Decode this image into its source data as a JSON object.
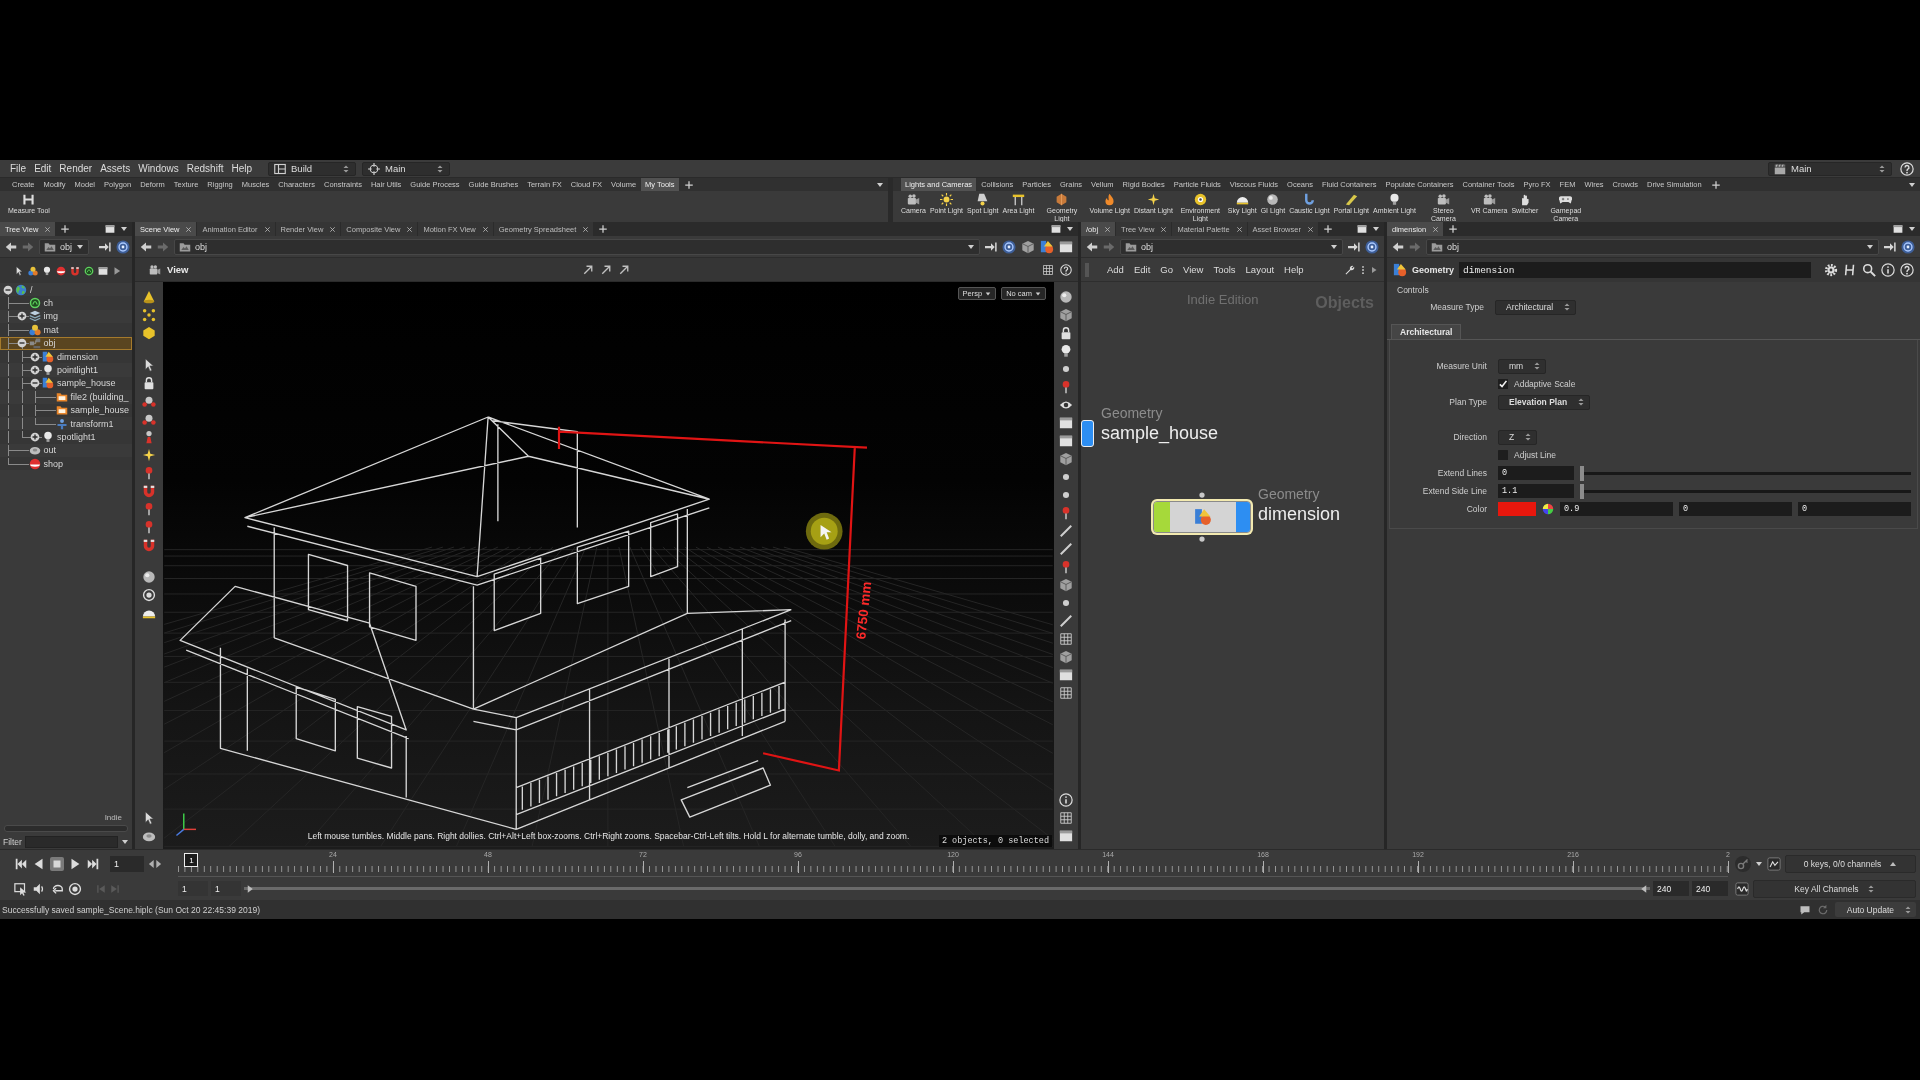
{
  "menu_bar": {
    "items": [
      "File",
      "Edit",
      "Render",
      "Assets",
      "Windows",
      "Redshift",
      "Help"
    ],
    "desktop": "Build",
    "main_menu": "Main",
    "right_menu": "Main"
  },
  "shelves": [
    {
      "tabs": [
        {
          "label": "Create",
          "selected": false
        },
        {
          "label": "Modify",
          "selected": false
        },
        {
          "label": "Model",
          "selected": false
        },
        {
          "label": "Polygon",
          "selected": false
        },
        {
          "label": "Deform",
          "selected": false
        },
        {
          "label": "Texture",
          "selected": false
        },
        {
          "label": "Rigging",
          "selected": false
        },
        {
          "label": "Muscles",
          "selected": false
        },
        {
          "label": "Characters",
          "selected": false
        },
        {
          "label": "Constraints",
          "selected": false
        },
        {
          "label": "Hair Utils",
          "selected": false
        },
        {
          "label": "Guide Process",
          "selected": false
        },
        {
          "label": "Guide Brushes",
          "selected": false
        },
        {
          "label": "Terrain FX",
          "selected": false
        },
        {
          "label": "Cloud FX",
          "selected": false
        },
        {
          "label": "Volume",
          "selected": false
        },
        {
          "label": "My Tools",
          "selected": true
        }
      ],
      "tools": [
        "Measure Tool"
      ]
    },
    {
      "tabs": [
        {
          "label": "Lights and Cameras",
          "selected": true
        },
        {
          "label": "Collisions",
          "selected": false
        },
        {
          "label": "Particles",
          "selected": false
        },
        {
          "label": "Grains",
          "selected": false
        },
        {
          "label": "Vellum",
          "selected": false
        },
        {
          "label": "Rigid Bodies",
          "selected": false
        },
        {
          "label": "Particle Fluids",
          "selected": false
        },
        {
          "label": "Viscous Fluids",
          "selected": false
        },
        {
          "label": "Oceans",
          "selected": false
        },
        {
          "label": "Fluid Containers",
          "selected": false
        },
        {
          "label": "Populate Containers",
          "selected": false
        },
        {
          "label": "Container Tools",
          "selected": false
        },
        {
          "label": "Pyro FX",
          "selected": false
        },
        {
          "label": "FEM",
          "selected": false
        },
        {
          "label": "Wires",
          "selected": false
        },
        {
          "label": "Crowds",
          "selected": false
        },
        {
          "label": "Drive Simulation",
          "selected": false
        }
      ],
      "tools": [
        "Camera",
        "Point Light",
        "Spot Light",
        "Area Light",
        "Geometry Light",
        "Volume Light",
        "Distant Light",
        "Environment Light",
        "Sky Light",
        "GI Light",
        "Caustic Light",
        "Portal Light",
        "Ambient Light",
        "Stereo Camera",
        "VR Camera",
        "Switcher",
        "Gamepad Camera"
      ]
    }
  ],
  "panes": {
    "tree_view": {
      "tabs": [
        {
          "label": "Tree View",
          "selected": true
        }
      ],
      "path": "obj",
      "items": [
        {
          "label": "/",
          "kind": "root",
          "expanded": true,
          "selected": false,
          "children": [
            {
              "label": "ch",
              "kind": "chop",
              "selected": false
            },
            {
              "label": "img",
              "kind": "cop",
              "expanded": false,
              "selected": false
            },
            {
              "label": "mat",
              "kind": "mat",
              "selected": false
            },
            {
              "label": "obj",
              "kind": "obj",
              "expanded": true,
              "selected": true,
              "children": [
                {
                  "label": "dimension",
                  "kind": "geo",
                  "expanded": false,
                  "selected": false
                },
                {
                  "label": "pointlight1",
                  "kind": "light",
                  "expanded": false,
                  "selected": false
                },
                {
                  "label": "sample_house",
                  "kind": "geo",
                  "expanded": true,
                  "selected": false,
                  "children": [
                    {
                      "label": "file2 (building_",
                      "kind": "file",
                      "selected": false
                    },
                    {
                      "label": "sample_house",
                      "kind": "file",
                      "selected": false
                    },
                    {
                      "label": "transform1",
                      "kind": "xform",
                      "selected": false
                    }
                  ]
                },
                {
                  "label": "spotlight1",
                  "kind": "light",
                  "expanded": false,
                  "selected": false
                }
              ]
            },
            {
              "label": "out",
              "kind": "rop",
              "selected": false
            },
            {
              "label": "shop",
              "kind": "shop",
              "selected": false
            }
          ]
        }
      ],
      "edition_label": "Indie",
      "filter_label": "Filter"
    },
    "scene_view": {
      "tabs": [
        {
          "label": "Scene View",
          "selected": true
        },
        {
          "label": "Animation Editor",
          "selected": false
        },
        {
          "label": "Render View",
          "selected": false
        },
        {
          "label": "Composite View",
          "selected": false
        },
        {
          "label": "Motion FX View",
          "selected": false
        },
        {
          "label": "Geometry Spreadsheet",
          "selected": false
        }
      ],
      "path": "obj",
      "viewport_title": "View",
      "camera_menus": [
        "Persp",
        "No cam"
      ],
      "dimension_label": "6750 mm",
      "hint": "Left mouse tumbles. Middle pans. Right dollies. Ctrl+Alt+Left box-zooms. Ctrl+Right zooms. Spacebar-Ctrl-Left tilts. Hold L for alternate tumble, dolly, and zoom.",
      "selection_info": "2 objects, 0 selected"
    },
    "network_view": {
      "tabs": [
        {
          "label": "/obj",
          "selected": true
        },
        {
          "label": "Tree View",
          "selected": false
        },
        {
          "label": "Material Palette",
          "selected": false
        },
        {
          "label": "Asset Browser",
          "selected": false
        }
      ],
      "path": "obj",
      "menu": [
        "Add",
        "Edit",
        "Go",
        "View",
        "Tools",
        "Layout",
        "Help"
      ],
      "edition_label": "Indie Edition",
      "context_label": "Objects",
      "nodes": [
        {
          "type_label": "Geometry",
          "name": "sample_house",
          "selected": false,
          "display_flag": true
        },
        {
          "type_label": "Geometry",
          "name": "dimension",
          "selected": true,
          "display_flag": true,
          "selectable_flag": true
        }
      ]
    },
    "parameters": {
      "tabs": [
        {
          "label": "dimension",
          "selected": true
        }
      ],
      "path": "obj",
      "node_type": "Geometry",
      "node_name": "dimension",
      "section_label": "Controls",
      "top_rows": [
        {
          "kind": "menu",
          "label": "Measure Type",
          "value": "Architectural",
          "changed": false
        }
      ],
      "folder_tabs": [
        {
          "label": "Architectural",
          "selected": true
        }
      ],
      "rows": [
        {
          "kind": "menu",
          "label": "Measure Unit",
          "value": "mm",
          "changed": false
        },
        {
          "kind": "checkbox",
          "label": "Addaptive Scale",
          "checked": true
        },
        {
          "kind": "menu",
          "label": "Plan Type",
          "value": "Elevation Plan",
          "changed": true
        },
        {
          "kind": "menu",
          "label": "Direction",
          "value": "Z",
          "changed": false
        },
        {
          "kind": "checkbox",
          "label": "Adjust Line",
          "checked": false
        },
        {
          "kind": "slider",
          "label": "Extend Lines",
          "value": "0",
          "level": 0
        },
        {
          "kind": "slider",
          "label": "Extend Side Line",
          "value": "1.1",
          "level": 0
        },
        {
          "kind": "color",
          "label": "Color",
          "color": "#e8170d",
          "values": [
            "0.9",
            "0",
            "0"
          ]
        }
      ]
    }
  },
  "playbar": {
    "stopped": true,
    "frame": "1",
    "current_frame": "1",
    "ruler_labels": [
      "24",
      "48",
      "72",
      "96",
      "120",
      "144",
      "168",
      "192",
      "216",
      "2"
    ],
    "start_fields": [
      "1",
      "1"
    ],
    "range_slider": {
      "level": 1
    },
    "end_fields": [
      "240",
      "240"
    ],
    "keys_info": "0 keys, 0/0 channels",
    "key_mode": "Key All Channels"
  },
  "status_bar": {
    "message": "Successfully saved sample_Scene.hiplc (Sun Oct 20 22:45:39 2019)",
    "update_mode": "Auto Update"
  }
}
